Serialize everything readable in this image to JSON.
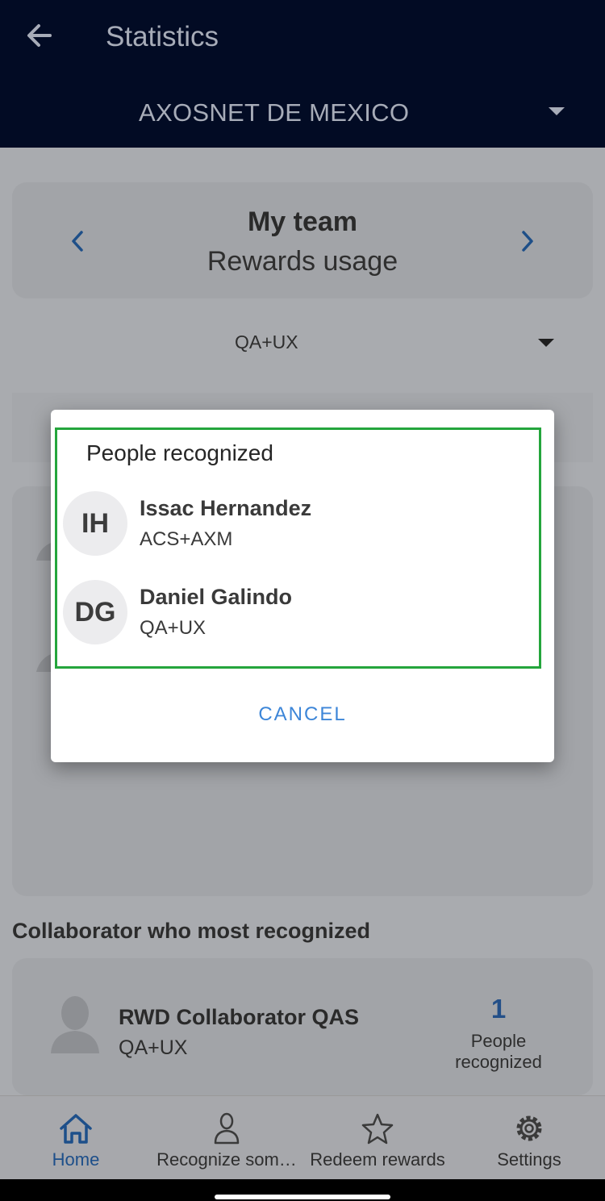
{
  "header": {
    "title": "Statistics",
    "company": "AXOSNET DE MEXICO"
  },
  "team_card": {
    "title": "My team",
    "subtitle": "Rewards usage"
  },
  "team_filter": {
    "selected": "QA+UX"
  },
  "dialog": {
    "title": "People recognized",
    "people": [
      {
        "initials": "IH",
        "name": "Issac Hernandez",
        "team": "ACS+AXM"
      },
      {
        "initials": "DG",
        "name": "Daniel Galindo",
        "team": "QA+UX"
      }
    ],
    "cancel_label": "CANCEL",
    "highlight_color": "#24a53c",
    "accent_color": "#3d86d8"
  },
  "most_recognized": {
    "section_title": "Collaborator who most recognized",
    "name": "RWD Collaborator QAS",
    "team": "QA+UX",
    "count": "1",
    "count_label": "People recognized"
  },
  "bottom_nav": {
    "items": [
      {
        "label": "Home",
        "icon": "home-icon"
      },
      {
        "label": "Recognize som…",
        "icon": "person-icon"
      },
      {
        "label": "Redeem rewards",
        "icon": "star-icon"
      },
      {
        "label": "Settings",
        "icon": "gear-icon"
      }
    ],
    "active_color": "#1d4f8a"
  },
  "colors": {
    "appbar": "#020b24",
    "brand_blue": "#2c74c9"
  }
}
